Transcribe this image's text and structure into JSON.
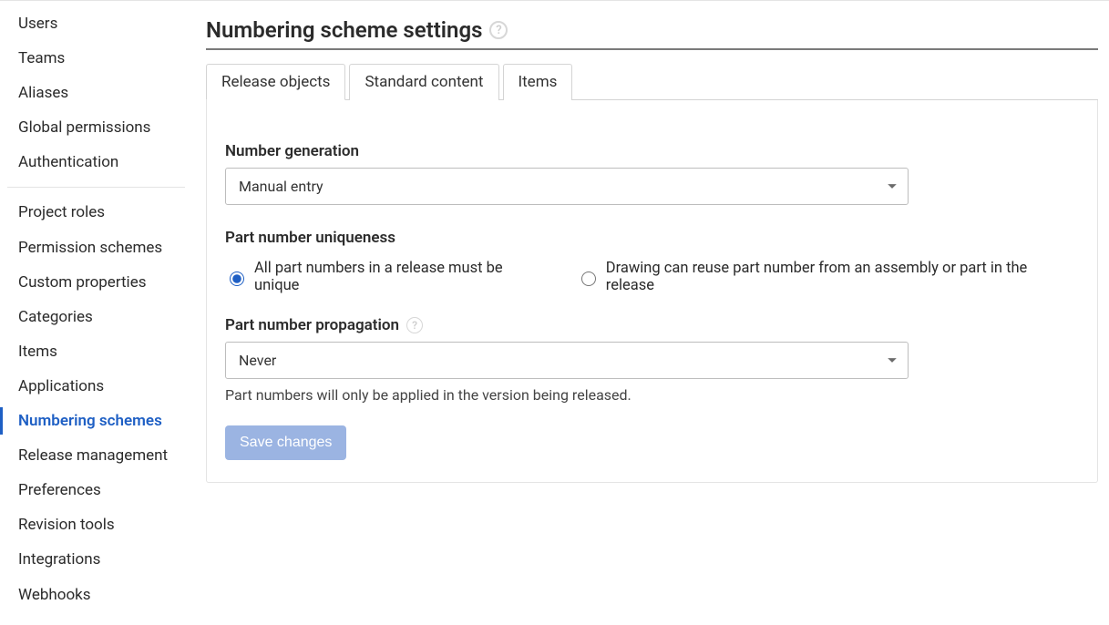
{
  "sidebar": {
    "group1": [
      {
        "label": "Users",
        "name": "sidebar-item-users"
      },
      {
        "label": "Teams",
        "name": "sidebar-item-teams"
      },
      {
        "label": "Aliases",
        "name": "sidebar-item-aliases"
      },
      {
        "label": "Global permissions",
        "name": "sidebar-item-global-permissions"
      },
      {
        "label": "Authentication",
        "name": "sidebar-item-authentication"
      }
    ],
    "group2": [
      {
        "label": "Project roles",
        "name": "sidebar-item-project-roles"
      },
      {
        "label": "Permission schemes",
        "name": "sidebar-item-permission-schemes"
      },
      {
        "label": "Custom properties",
        "name": "sidebar-item-custom-properties"
      },
      {
        "label": "Categories",
        "name": "sidebar-item-categories"
      },
      {
        "label": "Items",
        "name": "sidebar-item-items"
      },
      {
        "label": "Applications",
        "name": "sidebar-item-applications"
      },
      {
        "label": "Numbering schemes",
        "name": "sidebar-item-numbering-schemes",
        "active": true
      },
      {
        "label": "Release management",
        "name": "sidebar-item-release-management"
      },
      {
        "label": "Preferences",
        "name": "sidebar-item-preferences"
      },
      {
        "label": "Revision tools",
        "name": "sidebar-item-revision-tools"
      },
      {
        "label": "Integrations",
        "name": "sidebar-item-integrations"
      },
      {
        "label": "Webhooks",
        "name": "sidebar-item-webhooks"
      }
    ]
  },
  "page": {
    "title": "Numbering scheme settings"
  },
  "tabs": [
    {
      "label": "Release objects",
      "name": "tab-release-objects",
      "active": true
    },
    {
      "label": "Standard content",
      "name": "tab-standard-content"
    },
    {
      "label": "Items",
      "name": "tab-items"
    }
  ],
  "form": {
    "number_generation": {
      "label": "Number generation",
      "value": "Manual entry"
    },
    "uniqueness": {
      "label": "Part number uniqueness",
      "opt1": "All part numbers in a release must be unique",
      "opt2": "Drawing can reuse part number from an assembly or part in the release"
    },
    "propagation": {
      "label": "Part number propagation",
      "value": "Never",
      "hint": "Part numbers will only be applied in the version being released."
    },
    "save": "Save changes"
  }
}
